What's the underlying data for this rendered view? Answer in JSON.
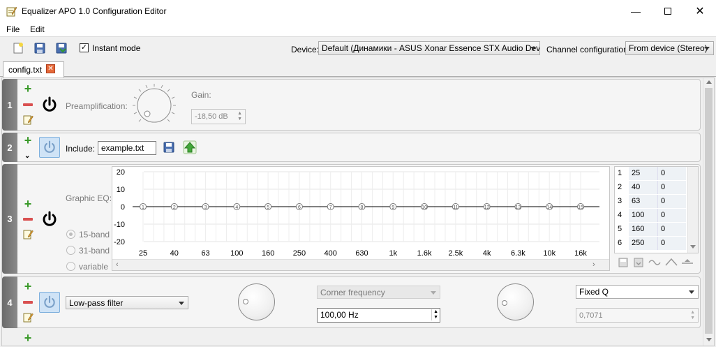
{
  "window": {
    "title": "Equalizer APO 1.0 Configuration Editor"
  },
  "menu": [
    "File",
    "Edit"
  ],
  "toolbar": {
    "instant_mode_label": "Instant mode",
    "instant_mode_checked": true,
    "device_label": "Device:",
    "device_value": "Default (Динамики - ASUS Xonar Essence STX Audio Device)",
    "channel_label": "Channel configuration:",
    "channel_value": "From device (Stereo)"
  },
  "tabs": [
    {
      "label": "config.txt"
    }
  ],
  "panel1": {
    "number": "1",
    "preamp_label": "Preamplification:",
    "gain_label": "Gain:",
    "gain_value": "-18,50 dB"
  },
  "panel2": {
    "number": "2",
    "include_label": "Include:",
    "include_value": "example.txt"
  },
  "panel3": {
    "number": "3",
    "title": "Graphic EQ:",
    "band_options": [
      "15-band",
      "31-band",
      "variable"
    ],
    "y_ticks": [
      "20",
      "10",
      "0",
      "-10",
      "-20"
    ],
    "x_ticks": [
      "25",
      "40",
      "63",
      "100",
      "160",
      "250",
      "400",
      "630",
      "1k",
      "1.6k",
      "2.5k",
      "4k",
      "6.3k",
      "10k",
      "16k"
    ],
    "node_labels": [
      "1",
      "2",
      "3",
      "4",
      "5",
      "6",
      "7",
      "8",
      "9",
      "10",
      "11",
      "12",
      "13",
      "14",
      "15"
    ],
    "table": [
      {
        "index": "1",
        "freq": "25",
        "gain": "0"
      },
      {
        "index": "2",
        "freq": "40",
        "gain": "0"
      },
      {
        "index": "3",
        "freq": "63",
        "gain": "0"
      },
      {
        "index": "4",
        "freq": "100",
        "gain": "0"
      },
      {
        "index": "5",
        "freq": "160",
        "gain": "0"
      },
      {
        "index": "6",
        "freq": "250",
        "gain": "0"
      }
    ]
  },
  "panel4": {
    "number": "4",
    "filter_type": "Low-pass filter",
    "param_select": "Corner frequency",
    "freq_value": "100,00 Hz",
    "q_select": "Fixed Q",
    "q_value": "0,7071"
  }
}
